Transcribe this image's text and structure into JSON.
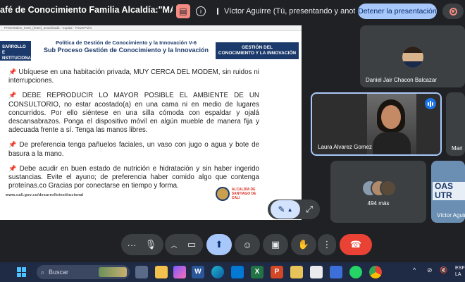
{
  "topbar": {
    "meeting_title": "afé de Conocimiento Familia Alcaldía:\"MÁS ALLÁ ...",
    "presenting_chip": "Víctor Aguirre (Tú, presentando y anota...",
    "stop_presenting": "Detener la presentación"
  },
  "slide": {
    "file_bar": "Presentation_meet_(2024)_actualizada - Copia2 - PowerPoint",
    "left_badge": "SARROLLO E\nNSTITUCIONAL",
    "title_line1": "Política de Gestión de Conocimiento y la Innovación V-6",
    "title_line2": "Sub Proceso Gestión de Conocimiento y la Innovación",
    "right_badge": "GESTIÓN DEL\nCONOCIMIENTO Y LA INNOVACIÓN",
    "bullets": [
      "Ubíquese en una habitación privada, MUY CERCA DEL MODEM, sin ruidos ni interrupciones.",
      "DEBE REPRODUCIR LO MAYOR POSIBLE EL AMBIENTE DE UN CONSULTORIO, no estar acostado(a) en una cama ni en medio de lugares concurridos. Por ello siéntese en una silla cómoda con espaldar y ojalá descansabrazos. Ponga el dispositivo móvil en algún mueble de manera fija y adecuada frente a sí. Tenga las manos libres.",
      "De preferencia tenga pañuelos faciales, un vaso con jugo o agua y bote de basura a la mano.",
      "Debe acudir en buen estado de nutrición e hidratación y sin haber ingerido sustancias. Evite el ayuno; de preferencia haber comido algo que contenga proteínas.co Gracias por conectarse en tiempo y forma."
    ],
    "url": "www.cali.gov.co/desarrolloinstitucional",
    "logo_text_1": "ALCALDÍA DE",
    "logo_text_2": "SANTIAGO DE CALI"
  },
  "participants": {
    "daniel": "Daniel Jair Chacon Balcazar",
    "laura": "Laura Alvarez Gomez",
    "mari": "Mari",
    "others_count": "494 más",
    "victor": "Víctor Aguir",
    "victor_sign": "OAS\nUTR"
  },
  "taskbar": {
    "search_placeholder": "Buscar",
    "tray_text_1": "ESF",
    "tray_text_2": "LA"
  },
  "colors": {
    "accent": "#a8c7fa",
    "end_call": "#ea4335",
    "slide_blue": "#1b3a6b"
  }
}
